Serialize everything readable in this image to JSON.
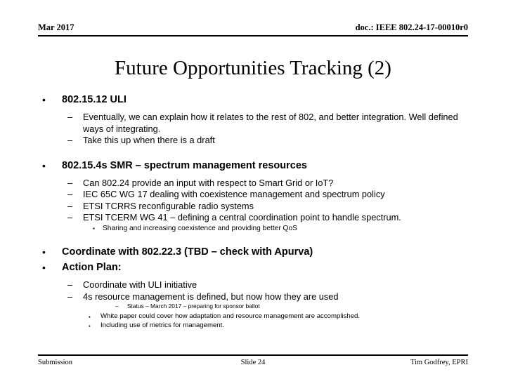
{
  "header": {
    "date": "Mar 2017",
    "doc": "doc.: IEEE 802.24-17-00010r0"
  },
  "title": "Future Opportunities Tracking (2)",
  "markers": {
    "bullet_round": "•",
    "bullet_dash": "–",
    "bullet_square": "▪"
  },
  "content": {
    "items": [
      {
        "level": 1,
        "text": "802.15.12 ULI"
      },
      {
        "level": 2,
        "text": "Eventually, we can explain how it relates to the rest of 802, and better integration. Well defined ways of integrating."
      },
      {
        "level": 2,
        "text": "Take this up when there is a draft"
      },
      {
        "level": 1,
        "text": "802.15.4s SMR – spectrum management resources"
      },
      {
        "level": 2,
        "text": "Can 802.24 provide an input with respect to Smart Grid or IoT?"
      },
      {
        "level": 2,
        "text": "IEC 65C WG 17 dealing with coexistence management and spectrum policy"
      },
      {
        "level": 2,
        "text": "ETSI TCRRS  reconfigurable radio systems"
      },
      {
        "level": 2,
        "text": "ETSI TCERM WG 41 – defining a central coordination point to handle spectrum."
      },
      {
        "level": 3,
        "text": "Sharing and increasing coexistence and providing better QoS"
      },
      {
        "level": 1,
        "text": "Coordinate with 802.22.3  (TBD – check with Apurva)"
      },
      {
        "level": 1,
        "text": "Action Plan:"
      },
      {
        "level": 2,
        "text": "Coordinate with ULI initiative"
      },
      {
        "level": 2,
        "text": "4s resource management is defined, but now how they are used"
      },
      {
        "level": 4,
        "text": "Status – March 2017 – preparing for sponsor ballot"
      },
      {
        "level": 3,
        "text": "White paper could cover how adaptation and resource management are accomplished."
      },
      {
        "level": 3,
        "text": "Including use of metrics for management."
      }
    ]
  },
  "footer": {
    "left": "Submission",
    "center": "Slide 24",
    "right": "Tim Godfrey, EPRI"
  }
}
